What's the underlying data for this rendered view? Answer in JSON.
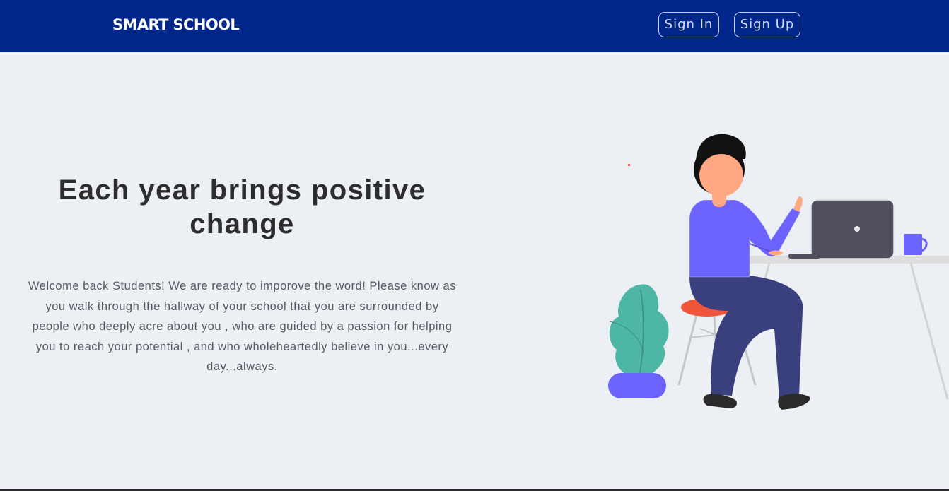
{
  "navbar": {
    "brand": "SMART SCHOOL",
    "signin_label": "Sign In",
    "signup_label": "Sign Up",
    "background_color": "#00268a"
  },
  "hero": {
    "title": "Each year brings positive change",
    "text": "Welcome back Students! We are ready to imporove the word! Please know as you walk through the hallway of your school that you are surrounded by people who deeply acre about you , who are guided by a passion for helping you to reach your potential , and who wholeheartedly believe in you...every day...always."
  },
  "illustration": {
    "subject": "person-working-at-laptop",
    "colors": {
      "shirt": "#6c63ff",
      "pants": "#3a3f7e",
      "skin": "#ffa883",
      "hair": "#111111",
      "laptop": "#4f4f5e",
      "stool": "#f0573a",
      "plant": "#4db6a5",
      "pot": "#6c63ff",
      "table": "#dedede"
    }
  }
}
